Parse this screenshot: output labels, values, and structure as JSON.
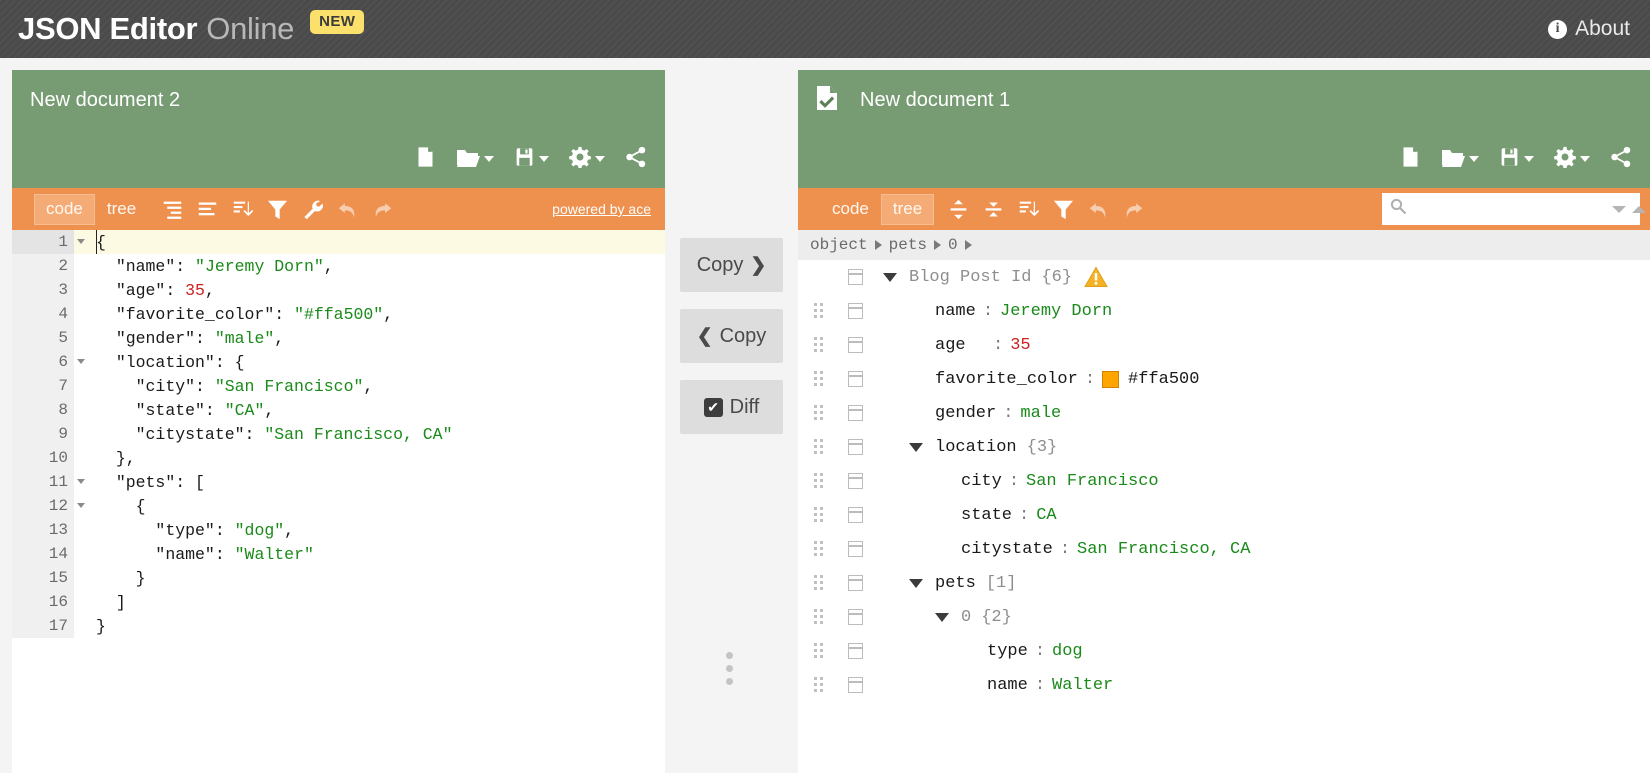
{
  "header": {
    "brand_strong": "JSON Editor",
    "brand_light": "Online",
    "new_badge": "NEW",
    "about_label": "About",
    "info_glyph": "i",
    "bg_color": "#4a4a4a",
    "badge_color": "#fbe16b"
  },
  "colors": {
    "panel_green": "#779b72",
    "toolbar_orange": "#ef914e",
    "active_tab_orange": "#f5ab75",
    "string_green": "#1a8a1a",
    "number_red": "#cc2222",
    "swatch_orange": "#ffa500",
    "warning_yellow": "#f5b225"
  },
  "left_panel": {
    "title": "New document 2",
    "menu_icons": [
      {
        "name": "new-file-icon",
        "has_caret": false
      },
      {
        "name": "open-folder-icon",
        "has_caret": true
      },
      {
        "name": "save-icon",
        "has_caret": true
      },
      {
        "name": "gear-icon",
        "has_caret": true
      },
      {
        "name": "share-icon",
        "has_caret": false
      }
    ],
    "modes": [
      {
        "label": "code",
        "active": true
      },
      {
        "label": "tree",
        "active": false
      }
    ],
    "tools": [
      {
        "name": "format-icon",
        "dim": false
      },
      {
        "name": "compact-icon",
        "dim": false
      },
      {
        "name": "sort-icon",
        "dim": false
      },
      {
        "name": "filter-icon",
        "dim": false
      },
      {
        "name": "repair-wrench-icon",
        "dim": false
      },
      {
        "name": "undo-icon",
        "dim": true
      },
      {
        "name": "redo-icon",
        "dim": true
      }
    ],
    "powered_by": "powered by ace",
    "code_lines": [
      {
        "num": "1",
        "fold": true,
        "active": true,
        "indent": 0,
        "tokens": [
          {
            "t": "pun",
            "v": "{"
          }
        ]
      },
      {
        "num": "2",
        "fold": false,
        "active": false,
        "indent": 1,
        "tokens": [
          {
            "t": "key",
            "v": "\"name\""
          },
          {
            "t": "pun",
            "v": ": "
          },
          {
            "t": "str",
            "v": "\"Jeremy Dorn\""
          },
          {
            "t": "pun",
            "v": ","
          }
        ]
      },
      {
        "num": "3",
        "fold": false,
        "active": false,
        "indent": 1,
        "tokens": [
          {
            "t": "key",
            "v": "\"age\""
          },
          {
            "t": "pun",
            "v": ": "
          },
          {
            "t": "num",
            "v": "35"
          },
          {
            "t": "pun",
            "v": ","
          }
        ]
      },
      {
        "num": "4",
        "fold": false,
        "active": false,
        "indent": 1,
        "tokens": [
          {
            "t": "key",
            "v": "\"favorite_color\""
          },
          {
            "t": "pun",
            "v": ": "
          },
          {
            "t": "str",
            "v": "\"#ffa500\""
          },
          {
            "t": "pun",
            "v": ","
          }
        ]
      },
      {
        "num": "5",
        "fold": false,
        "active": false,
        "indent": 1,
        "tokens": [
          {
            "t": "key",
            "v": "\"gender\""
          },
          {
            "t": "pun",
            "v": ": "
          },
          {
            "t": "str",
            "v": "\"male\""
          },
          {
            "t": "pun",
            "v": ","
          }
        ]
      },
      {
        "num": "6",
        "fold": true,
        "active": false,
        "indent": 1,
        "tokens": [
          {
            "t": "key",
            "v": "\"location\""
          },
          {
            "t": "pun",
            "v": ": {"
          }
        ]
      },
      {
        "num": "7",
        "fold": false,
        "active": false,
        "indent": 2,
        "tokens": [
          {
            "t": "key",
            "v": "\"city\""
          },
          {
            "t": "pun",
            "v": ": "
          },
          {
            "t": "str",
            "v": "\"San Francisco\""
          },
          {
            "t": "pun",
            "v": ","
          }
        ]
      },
      {
        "num": "8",
        "fold": false,
        "active": false,
        "indent": 2,
        "tokens": [
          {
            "t": "key",
            "v": "\"state\""
          },
          {
            "t": "pun",
            "v": ": "
          },
          {
            "t": "str",
            "v": "\"CA\""
          },
          {
            "t": "pun",
            "v": ","
          }
        ]
      },
      {
        "num": "9",
        "fold": false,
        "active": false,
        "indent": 2,
        "tokens": [
          {
            "t": "key",
            "v": "\"citystate\""
          },
          {
            "t": "pun",
            "v": ": "
          },
          {
            "t": "str",
            "v": "\"San Francisco, CA\""
          }
        ]
      },
      {
        "num": "10",
        "fold": false,
        "active": false,
        "indent": 1,
        "tokens": [
          {
            "t": "pun",
            "v": "},"
          }
        ]
      },
      {
        "num": "11",
        "fold": true,
        "active": false,
        "indent": 1,
        "tokens": [
          {
            "t": "key",
            "v": "\"pets\""
          },
          {
            "t": "pun",
            "v": ": ["
          }
        ]
      },
      {
        "num": "12",
        "fold": true,
        "active": false,
        "indent": 2,
        "tokens": [
          {
            "t": "pun",
            "v": "{"
          }
        ]
      },
      {
        "num": "13",
        "fold": false,
        "active": false,
        "indent": 3,
        "tokens": [
          {
            "t": "key",
            "v": "\"type\""
          },
          {
            "t": "pun",
            "v": ": "
          },
          {
            "t": "str",
            "v": "\"dog\""
          },
          {
            "t": "pun",
            "v": ","
          }
        ]
      },
      {
        "num": "14",
        "fold": false,
        "active": false,
        "indent": 3,
        "tokens": [
          {
            "t": "key",
            "v": "\"name\""
          },
          {
            "t": "pun",
            "v": ": "
          },
          {
            "t": "str",
            "v": "\"Walter\""
          }
        ]
      },
      {
        "num": "15",
        "fold": false,
        "active": false,
        "indent": 2,
        "tokens": [
          {
            "t": "pun",
            "v": "}"
          }
        ]
      },
      {
        "num": "16",
        "fold": false,
        "active": false,
        "indent": 1,
        "tokens": [
          {
            "t": "pun",
            "v": "]"
          }
        ]
      },
      {
        "num": "17",
        "fold": false,
        "active": false,
        "indent": 0,
        "tokens": [
          {
            "t": "pun",
            "v": "}"
          }
        ]
      }
    ]
  },
  "middle": {
    "copy_right_label": "Copy",
    "copy_right_chevron": "❯",
    "copy_left_label": "Copy",
    "copy_left_chevron": "❮",
    "diff_label": "Diff",
    "diff_checked": true,
    "check_glyph": "✔"
  },
  "right_panel": {
    "title": "New document 1",
    "doc_icon": "document-check-icon",
    "menu_icons": [
      {
        "name": "new-file-icon",
        "has_caret": false
      },
      {
        "name": "open-folder-icon",
        "has_caret": true
      },
      {
        "name": "save-icon",
        "has_caret": true
      },
      {
        "name": "gear-icon",
        "has_caret": true
      },
      {
        "name": "share-icon",
        "has_caret": false
      }
    ],
    "modes": [
      {
        "label": "code",
        "active": false
      },
      {
        "label": "tree",
        "active": true
      }
    ],
    "tools": [
      {
        "name": "expand-all-icon",
        "dim": false
      },
      {
        "name": "collapse-all-icon",
        "dim": false
      },
      {
        "name": "sort-icon",
        "dim": false
      },
      {
        "name": "filter-icon",
        "dim": false
      },
      {
        "name": "undo-icon",
        "dim": true
      },
      {
        "name": "redo-icon",
        "dim": true
      }
    ],
    "search": {
      "value": "",
      "placeholder": ""
    },
    "breadcrumb": [
      "object",
      "pets",
      "0"
    ],
    "tree_rows": [
      {
        "handle": false,
        "expander": "open",
        "indent": 0,
        "key": "Blog Post Id",
        "key_muted": true,
        "sep": false,
        "value": "",
        "count": "{6}",
        "warning": true
      },
      {
        "handle": true,
        "expander": "none",
        "indent": 2,
        "key": "name",
        "key_muted": false,
        "sep": true,
        "value": "Jeremy Dorn",
        "value_type": "string"
      },
      {
        "handle": true,
        "expander": "none",
        "indent": 2,
        "key": "age  ",
        "key_muted": false,
        "sep": true,
        "value": "35",
        "value_type": "number"
      },
      {
        "handle": true,
        "expander": "none",
        "indent": 2,
        "key": "favorite_color",
        "key_muted": false,
        "sep": true,
        "value": "#ffa500",
        "value_type": "color",
        "swatch": "#ffa500"
      },
      {
        "handle": true,
        "expander": "none",
        "indent": 2,
        "key": "gender",
        "key_muted": false,
        "sep": true,
        "value": "male",
        "value_type": "string"
      },
      {
        "handle": true,
        "expander": "open",
        "indent": 1,
        "key": "location",
        "key_muted": false,
        "sep": false,
        "value": "",
        "count": "{3}"
      },
      {
        "handle": true,
        "expander": "none",
        "indent": 3,
        "key": "city",
        "key_muted": false,
        "sep": true,
        "value": "San Francisco",
        "value_type": "string"
      },
      {
        "handle": true,
        "expander": "none",
        "indent": 3,
        "key": "state",
        "key_muted": false,
        "sep": true,
        "value": "CA",
        "value_type": "string"
      },
      {
        "handle": true,
        "expander": "none",
        "indent": 3,
        "key": "citystate",
        "key_muted": false,
        "sep": true,
        "value": "San Francisco, CA",
        "value_type": "string"
      },
      {
        "handle": true,
        "expander": "open",
        "indent": 1,
        "key": "pets",
        "key_muted": false,
        "sep": false,
        "value": "",
        "count": "[1]"
      },
      {
        "handle": true,
        "expander": "open",
        "indent": 2,
        "key": "0",
        "key_muted": true,
        "sep": false,
        "value": "",
        "count": "{2}"
      },
      {
        "handle": true,
        "expander": "none",
        "indent": 4,
        "key": "type",
        "key_muted": false,
        "sep": true,
        "value": "dog",
        "value_type": "string"
      },
      {
        "handle": true,
        "expander": "none",
        "indent": 4,
        "key": "name",
        "key_muted": false,
        "sep": true,
        "value": "Walter",
        "value_type": "string"
      }
    ]
  }
}
